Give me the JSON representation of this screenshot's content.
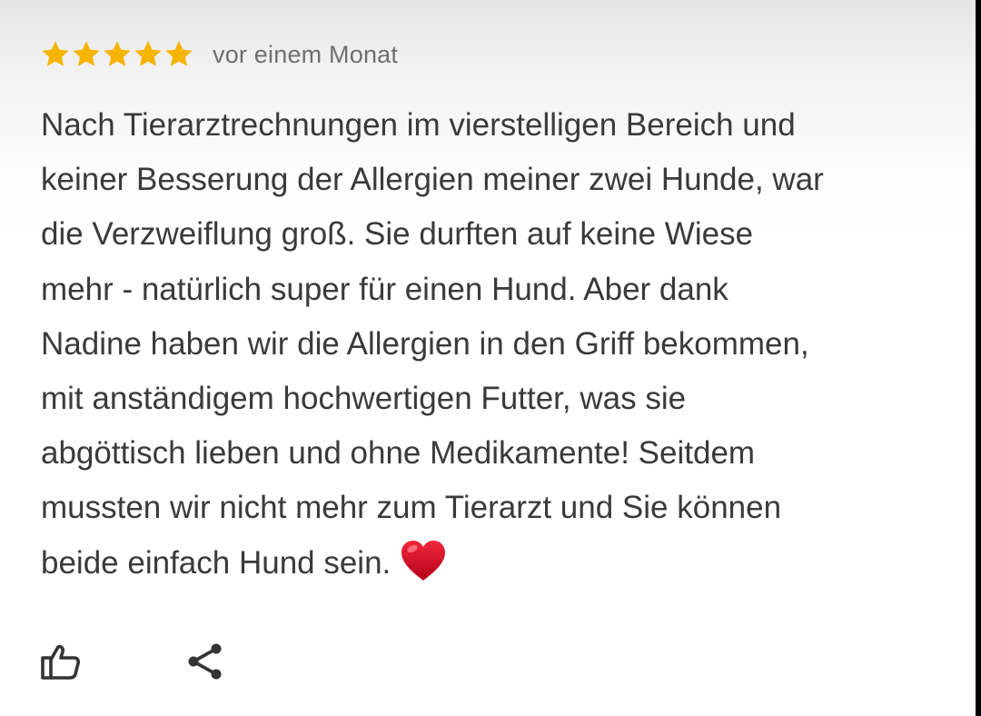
{
  "review": {
    "rating": 5,
    "rating_max": 5,
    "star_color": "#F5B400",
    "date": "vor einem Monat",
    "lines": [
      "Nach Tierarztrechnungen im vierstelligen Bereich und",
      "keiner Besserung der Allergien meiner zwei Hunde, war",
      "die Verzweiflung groß. Sie durften auf keine Wiese",
      "mehr - natürlich super für einen Hund. Aber dank",
      "Nadine haben wir die Allergien in den Griff bekommen,",
      "mit anständigem hochwertigen Futter, was sie",
      "abgöttisch lieben und ohne Medikamente! Seitdem",
      "mussten wir nicht mehr zum Tierarzt und Sie können",
      "beide einfach Hund sein."
    ],
    "emoji": "red-heart-icon"
  },
  "actions": {
    "like_icon": "thumbs-up-icon",
    "share_icon": "share-icon"
  }
}
